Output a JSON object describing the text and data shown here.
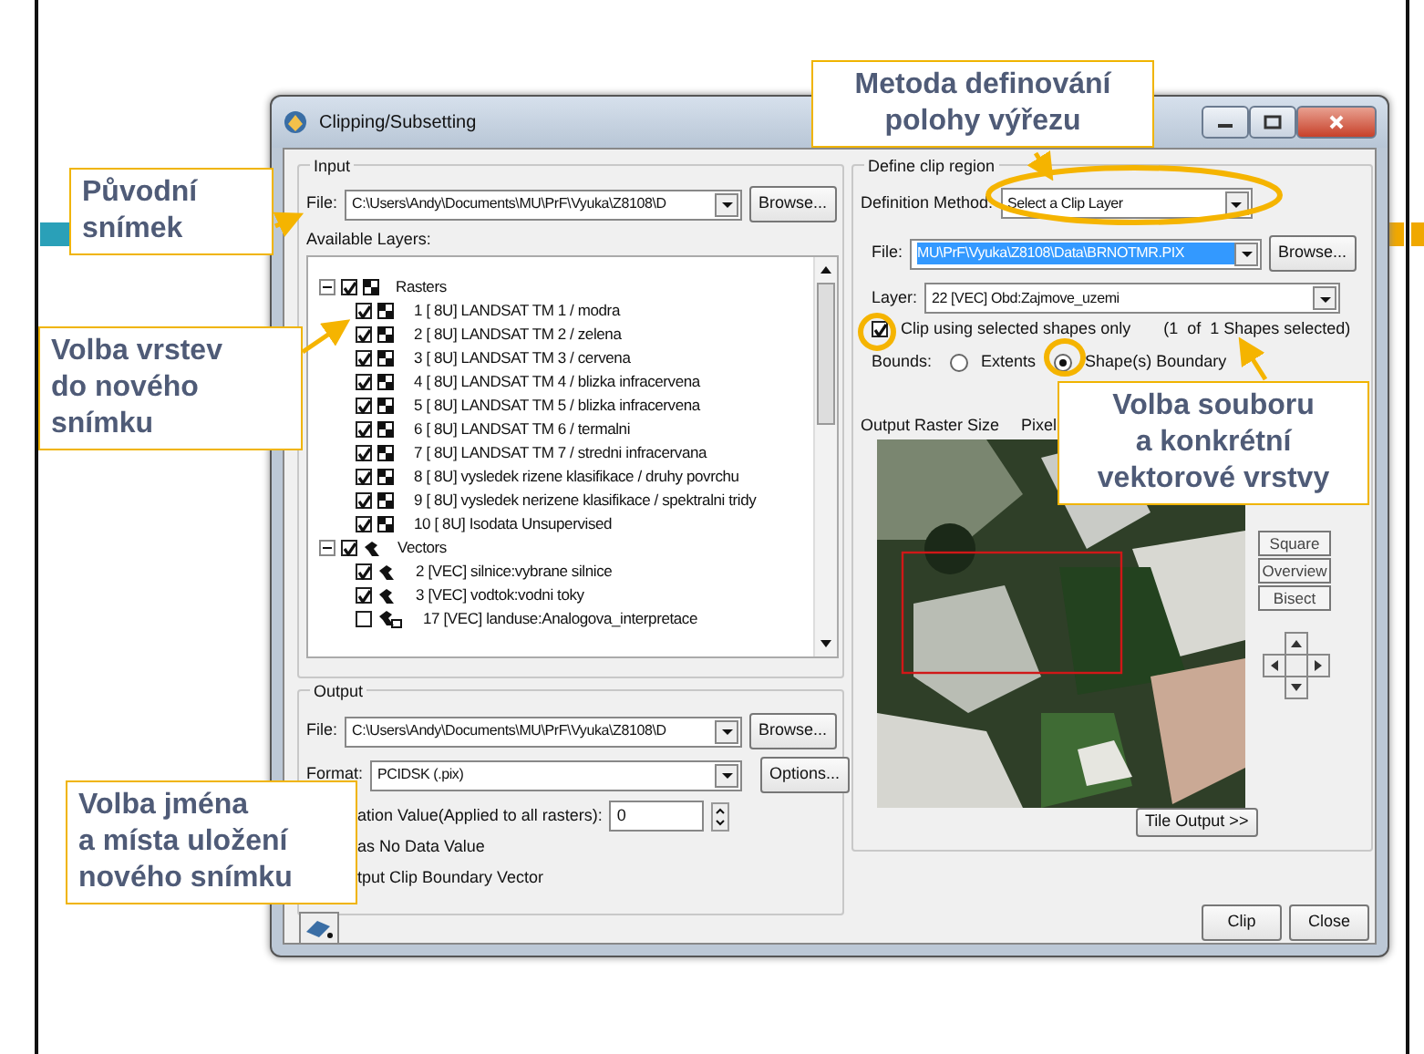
{
  "window": {
    "title": "Clipping/Subsetting"
  },
  "input": {
    "legend": "Input",
    "file_label": "File:",
    "file_value": "C:\\Users\\Andy\\Documents\\MU\\PrF\\Vyuka\\Z8108\\D",
    "browse": "Browse...",
    "layers_label": "Available Layers:",
    "layers": [
      {
        "label": "Rasters",
        "kind": "raster",
        "checked": true,
        "expanded": true,
        "children": [
          {
            "label": "1 [ 8U] LANDSAT TM 1 / modra",
            "kind": "raster",
            "checked": true
          },
          {
            "label": "2 [ 8U] LANDSAT TM 2 / zelena",
            "kind": "raster",
            "checked": true
          },
          {
            "label": "3 [ 8U] LANDSAT TM 3 / cervena",
            "kind": "raster",
            "checked": true
          },
          {
            "label": "4 [ 8U] LANDSAT TM 4 / blizka infracervena",
            "kind": "raster",
            "checked": true
          },
          {
            "label": "5 [ 8U] LANDSAT TM 5 / blizka infracervena",
            "kind": "raster",
            "checked": true
          },
          {
            "label": "6 [ 8U] LANDSAT TM 6 / termalni",
            "kind": "raster",
            "checked": true
          },
          {
            "label": "7 [ 8U] LANDSAT TM 7 / stredni infracervana",
            "kind": "raster",
            "checked": true
          },
          {
            "label": "8 [ 8U] vysledek rizene klasifikace / druhy povrchu",
            "kind": "raster",
            "checked": true
          },
          {
            "label": "9 [ 8U] vysledek nerizene klasifikace / spektralni tridy",
            "kind": "raster",
            "checked": true
          },
          {
            "label": "10 [ 8U] Isodata Unsupervised",
            "kind": "raster",
            "checked": true
          }
        ]
      },
      {
        "label": "Vectors",
        "kind": "vector",
        "checked": true,
        "expanded": true,
        "children": [
          {
            "label": "2 [VEC] silnice:vybrane silnice",
            "kind": "vector",
            "checked": true
          },
          {
            "label": "3 [VEC] vodtok:vodni toky",
            "kind": "vector",
            "checked": true
          },
          {
            "label": "17 [VEC] landuse:Analogova_interpretace",
            "kind": "vector-link",
            "checked": false
          }
        ]
      }
    ]
  },
  "output": {
    "legend": "Output",
    "file_label": "File:",
    "file_value": "C:\\Users\\Andy\\Documents\\MU\\PrF\\Vyuka\\Z8108\\D",
    "browse": "Browse...",
    "format_label": "Format:",
    "format_value": "PCIDSK (.pix)",
    "options": "Options...",
    "nodata_label": "ation Value(Applied to all rasters):",
    "nodata_value": "0",
    "option_rows": [
      "as No Data Value",
      "tput Clip Boundary Vector"
    ]
  },
  "clip_region": {
    "legend": "Define clip region",
    "method_label": "Definition Method:",
    "method_value": "Select a Clip Layer",
    "file_label": "File:",
    "file_value": "MU\\PrF\\Vyuka\\Z8108\\Data\\BRNOTMR.PIX",
    "browse": "Browse...",
    "layer_label": "Layer:",
    "layer_value": "22 [VEC] Obd:Zajmove_uzemi",
    "selected_only": {
      "label": "Clip using selected shapes only",
      "checked": true
    },
    "shapes_count": "(1  of  1 Shapes selected)",
    "bounds_label": "Bounds:",
    "bounds": [
      {
        "label": "Extents",
        "selected": false
      },
      {
        "label": "Shape(s) Boundary",
        "selected": true
      }
    ],
    "size_label": "Output Raster Size",
    "pixel_label": "Pixel",
    "side_buttons": [
      "Square",
      "Overview",
      "Bisect"
    ],
    "tile_output": "Tile Output >>"
  },
  "buttons": [
    "Clip",
    "Close"
  ],
  "callouts": [
    {
      "text": "Původní\nsnímek"
    },
    {
      "text": "Volba vrstev\ndo nového\nsnímku"
    },
    {
      "text": "Volba jména\na místa uložení\nnového snímku"
    },
    {
      "text": "Metoda definování\npolohy výřezu"
    },
    {
      "text": "Volba souboru\na konkrétní\nvektorové vrstvy"
    }
  ]
}
